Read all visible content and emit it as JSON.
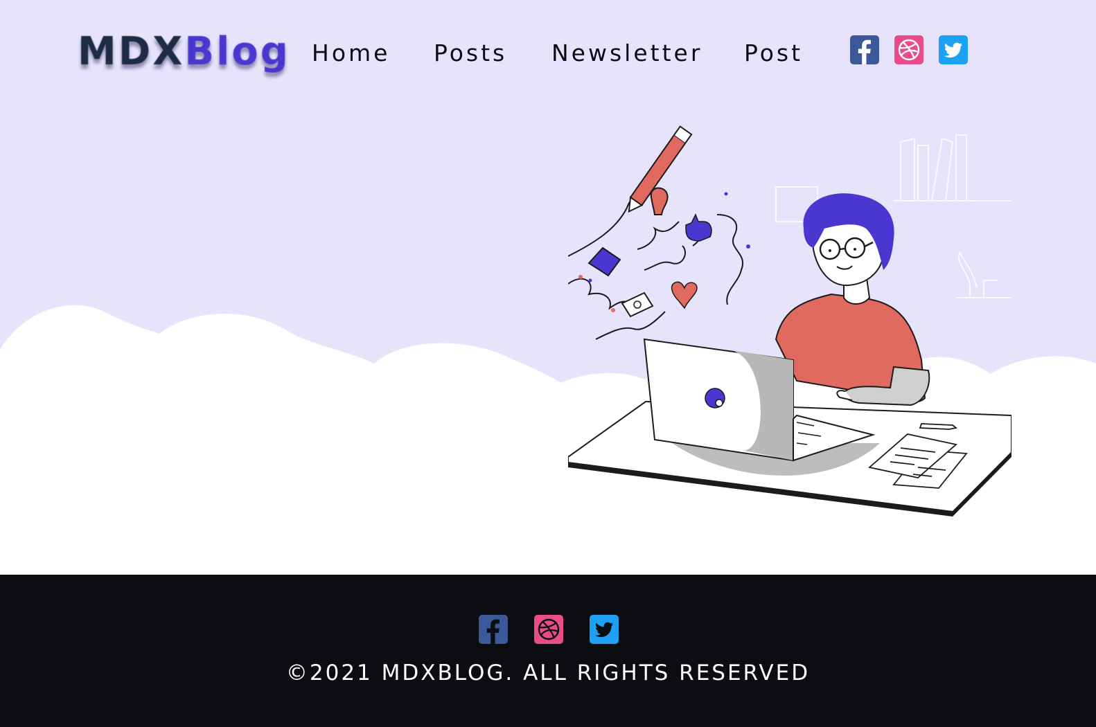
{
  "header": {
    "logo": {
      "part1": "MDX",
      "part2": "Blog"
    },
    "nav": [
      {
        "label": "Home"
      },
      {
        "label": "Posts"
      },
      {
        "label": "Newsletter"
      },
      {
        "label": "Post"
      }
    ],
    "social": [
      "facebook-icon",
      "dribbble-icon",
      "twitter-icon"
    ]
  },
  "footer": {
    "social": [
      "facebook-icon",
      "dribbble-icon",
      "twitter-icon"
    ],
    "copyright": "©2021 MDXBLOG. ALL RIGHTS RESERVED"
  },
  "colors": {
    "hero_background": "#e6e3fb",
    "accent": "#4a37d0",
    "footer_background": "#0c0d12",
    "facebook": "#3b5998",
    "dribbble": "#ea4c89",
    "twitter": "#1da1f2",
    "shirt": "#e06a5f"
  }
}
